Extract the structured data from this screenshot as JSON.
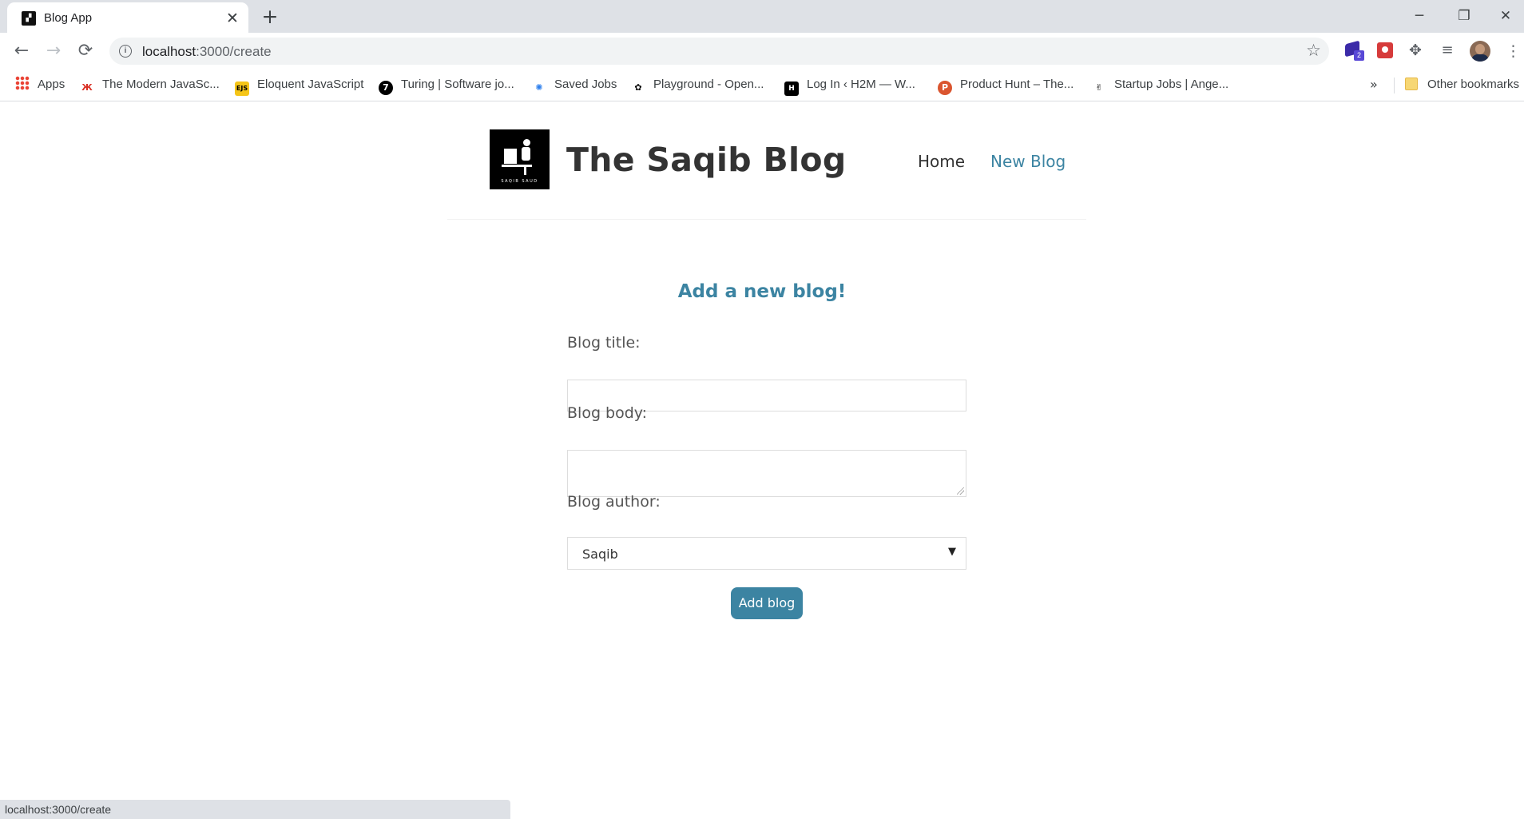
{
  "browser": {
    "tab_title": "Blog App",
    "tab_close": "✕",
    "new_tab": "+",
    "url_host": "localhost",
    "url_path": ":3000/create",
    "extension_badge": "2",
    "window_controls": {
      "minimize": "─",
      "restore": "❐",
      "close": "✕"
    },
    "nav": {
      "back": "←",
      "forward": "→",
      "reload": "⟳",
      "star": "☆",
      "puzzle": "✥",
      "media": "≡",
      "menu": "⋮"
    }
  },
  "bookmarks": {
    "items": [
      {
        "label": "Apps",
        "icon": "apps-grid-icon"
      },
      {
        "label": "The Modern JavaSc...",
        "icon": "modern-js-icon",
        "icon_text": "Ж",
        "icon_color": "#d93025"
      },
      {
        "label": "Eloquent JavaScript",
        "icon": "ejs-icon",
        "icon_text": "EJS",
        "icon_color": "#f5c518"
      },
      {
        "label": "Turing | Software jo...",
        "icon": "turing-icon",
        "icon_text": "7",
        "icon_color": "#000000"
      },
      {
        "label": "Saved Jobs",
        "icon": "lightbulb-icon",
        "icon_text": "✺",
        "icon_color": "#2f80ed"
      },
      {
        "label": "Playground - Open...",
        "icon": "openai-icon",
        "icon_text": "✿",
        "icon_color": "#000000"
      },
      {
        "label": "Log In ‹ H2M — W...",
        "icon": "h2m-icon",
        "icon_text": "H",
        "icon_color": "#000000"
      },
      {
        "label": "Product Hunt – The...",
        "icon": "product-hunt-icon",
        "icon_text": "P",
        "icon_color": "#da552f"
      },
      {
        "label": "Startup Jobs | Ange...",
        "icon": "angellist-icon",
        "icon_text": "✌",
        "icon_color": "#000000"
      }
    ],
    "more": "»",
    "other": "Other bookmarks"
  },
  "site": {
    "logo_caption": "SAQIB SAUD",
    "title": "The Saqib Blog",
    "nav": {
      "home": "Home",
      "new_blog": "New Blog"
    }
  },
  "form": {
    "heading": "Add a new blog!",
    "title_label": "Blog title:",
    "title_value": "",
    "body_label": "Blog body:",
    "body_value": "",
    "author_label": "Blog author:",
    "author_selected": "Saqib",
    "submit_label": "Add blog"
  },
  "status_bar": "localhost:3000/create",
  "colors": {
    "accent": "#3c84a2",
    "title": "#333333"
  }
}
